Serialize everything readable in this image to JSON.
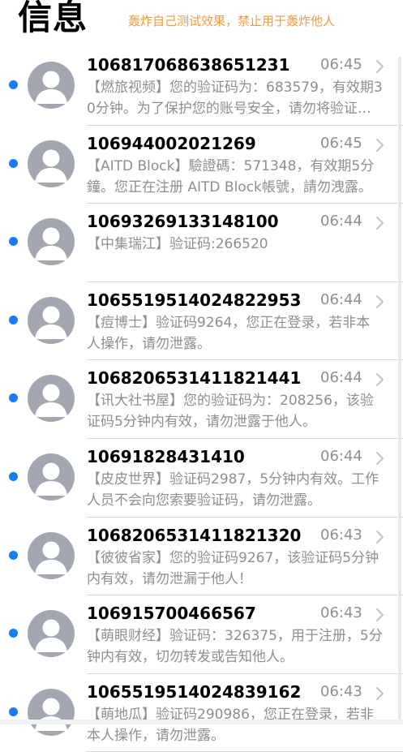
{
  "header": {
    "title": "信息",
    "warning": "轰炸自己测试效果，禁止用于轰炸他人"
  },
  "colors": {
    "unread_dot": "#1a7cf5",
    "avatar_bg": "#a3a7b0",
    "warning_text": "#f39a3f",
    "secondary_text": "#8e8e93"
  },
  "icons": {
    "unread": "unread-dot-icon",
    "avatar": "person-avatar-icon",
    "disclosure": "chevron-right-icon"
  },
  "messages": [
    {
      "sender": "10681706863865​1231",
      "time": "06:45",
      "preview": "【燃旅视频】您的验证码为：683579，有效期30分钟。为了保护您的账号安全，请勿将验证码告知他人。"
    },
    {
      "sender": "106944002021269",
      "time": "06:45",
      "preview": "【AITD Block】驗證碼：571348，有效期5分鐘。您正在注册 AITD Block帳號，請勿洩露。"
    },
    {
      "sender": "10693269133148100",
      "time": "06:44",
      "preview": "【中集瑞江】验证码:266520"
    },
    {
      "sender": "1065519514024822953",
      "time": "06:44",
      "preview": "【痘博士】验证码9264，您正在登录，若非本人操作，请勿泄露。"
    },
    {
      "sender": "1068206531411821441",
      "time": "06:44",
      "preview": "【讯大社书屋】您的验证码为：208256，该验证码5分钟内有效，请勿泄露于他人。"
    },
    {
      "sender": "10691828431410",
      "time": "06:44",
      "preview": "【皮皮世界】验证码2987，5分钟内有效。工作人员不会向您索要验证码，请勿泄露。"
    },
    {
      "sender": "1068206531411821320",
      "time": "06:43",
      "preview": "【彼彼省家】您的验证码9267，该验证码5分钟内有效，请勿泄漏于他人！"
    },
    {
      "sender": "106915700466567",
      "time": "06:43",
      "preview": "【萌眼财经】验证码：326375，用于注册，5分钟内有效，切勿转发或告知他人。"
    },
    {
      "sender": "1065519514024839162",
      "time": "06:43",
      "preview": "【萌地瓜】验证码290986，您正在登录，若非本人操作，请勿泄露。"
    }
  ]
}
